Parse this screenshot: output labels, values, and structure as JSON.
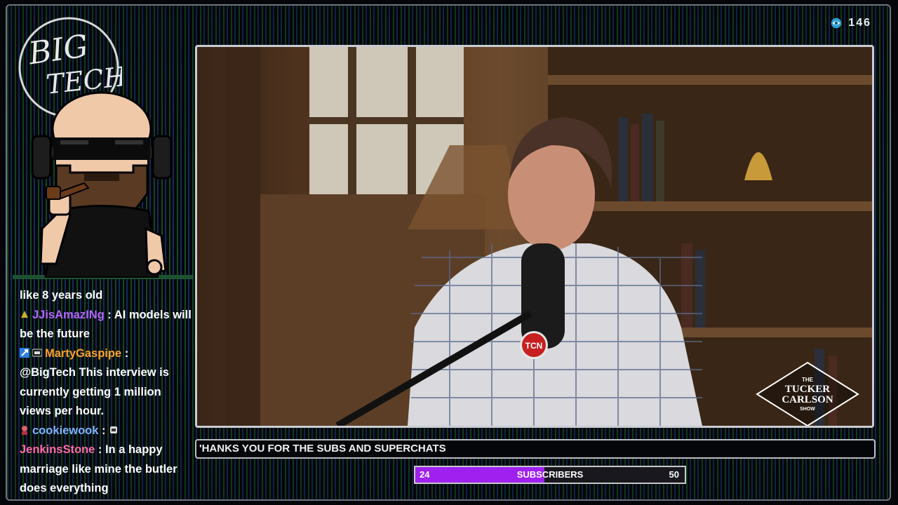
{
  "stream": {
    "viewer_count": "146",
    "logo_text": [
      "BIG",
      "TECH"
    ]
  },
  "video": {
    "show_logo": [
      "THE",
      "TUCKER",
      "CARLSON",
      "SHOW"
    ],
    "mic_label": "TCN"
  },
  "ticker": {
    "text": "'HANKS YOU FOR THE SUBS AND SUPERCHATS"
  },
  "subscriber_goal": {
    "current": "24",
    "label": "SUBSCRIBERS",
    "goal": "50",
    "progress": 0.48
  },
  "chat": {
    "messages": [
      {
        "username": "",
        "sep": "",
        "text": "like 8 years old"
      },
      {
        "username": "JJisAmazINg",
        "sep": " : ",
        "text": "AI models will be the future"
      },
      {
        "username": "MartyGaspipe",
        "sep": " :",
        "text": "@BigTech This interview is currently getting 1 million views per hour."
      },
      {
        "username": "cookiewook",
        "sep": " : ",
        "text": ""
      },
      {
        "username": "JenkinsStone",
        "sep": " : ",
        "text": "In a happy marriage like mine the butler does everything"
      }
    ]
  },
  "colors": {
    "progress_fill": "#a020f0",
    "username_purple": "#b565ff",
    "username_orange": "#ffa22b",
    "username_blue": "#7fb2ff",
    "username_pink": "#ff6aa8"
  }
}
